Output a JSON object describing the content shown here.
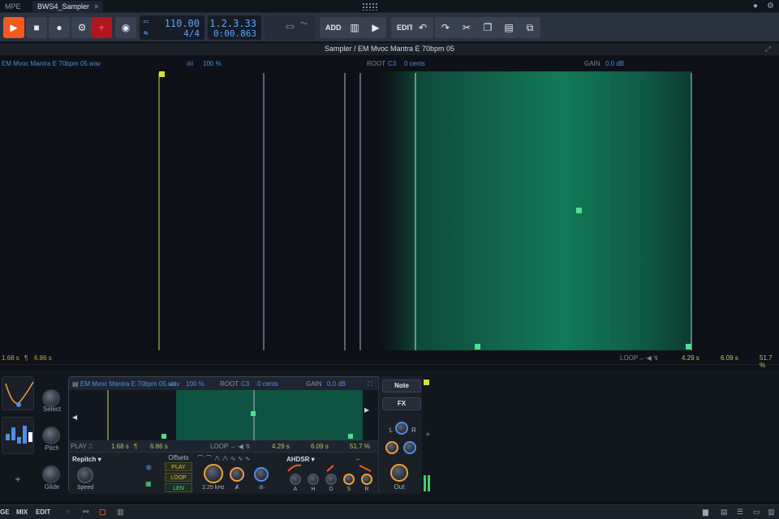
{
  "tabs": {
    "left": "MPE",
    "active": "BWS4_Sampler",
    "close": "×"
  },
  "transport": {
    "tempo": "110.00",
    "signature": "4/4",
    "position_bars": "1.2.3.33",
    "position_time": "0:00.863",
    "add_label": "ADD",
    "edit_label": "EDIT"
  },
  "editor": {
    "title": "Sampler / EM Mvoc Mantra E 70bpm 05",
    "filename": "EM Mvoc Mantra E 70bpm 05.wav",
    "zoom": "100 %",
    "root_label": "ROOT",
    "root_note": "C3",
    "root_cents": "0 cents",
    "gain_label": "GAIN",
    "gain_value": "0.0 dB"
  },
  "footer": {
    "play_start": "1.68 s",
    "play_end": "6.86 s",
    "loop_label": "LOOP",
    "loop_start": "4.29 s",
    "loop_end": "6.09 s",
    "loop_percent": "51.7 %"
  },
  "device": {
    "filename": "EM Mvoc Mantra E 70bpm 05.wav",
    "zoom": "100 %",
    "root_label": "ROOT",
    "root_note": "C3",
    "root_cents": "0 cents",
    "gain_label": "GAIN",
    "gain_value": "0.0 dB",
    "play_label": "PLAY",
    "play_start": "1.68 s",
    "play_end": "6.86 s",
    "loop_label": "LOOP",
    "loop_start": "4.29 s",
    "loop_end": "6.09 s",
    "loop_percent": "51.7 %",
    "mode": "Repitch",
    "speed_label": "Speed",
    "offsets_label": "Offsets",
    "offset_play": "PLAY",
    "offset_loop": "LOOP",
    "offset_len": "LEN",
    "filter_freq": "2.25 kHz",
    "env_title": "AHDSR",
    "env_a": "A",
    "env_h": "H",
    "env_d": "D",
    "env_s": "S",
    "env_r": "R",
    "note_btn": "Note",
    "fx_btn": "FX",
    "out_label": "Out",
    "l_label": "L",
    "r_label": "R"
  },
  "leftpanel": {
    "select_label": "Select",
    "pitch_label": "Pitch",
    "glide_label": "Glide",
    "add": "+"
  },
  "bottombar": {
    "arrange": "GE",
    "mix": "MIX",
    "edit": "EDIT"
  },
  "colors": {
    "accent_orange": "#f25a1f",
    "loop_green": "#1aa779",
    "lcd_blue": "#59a7ff",
    "marker_yellow": "#d5e034"
  }
}
